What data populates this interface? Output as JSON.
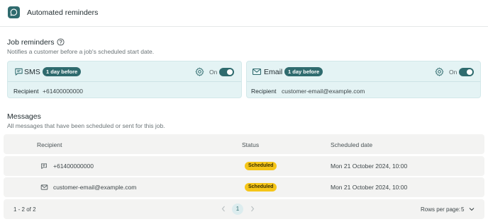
{
  "header": {
    "title": "Automated reminders",
    "icon": "chat-bubble-icon"
  },
  "job_reminders": {
    "title": "Job reminders",
    "subtitle": "Notifies a customer before a job's scheduled start date.",
    "cards": [
      {
        "channel": "SMS",
        "badge": "1 day before",
        "toggle_label": "On",
        "enabled": true,
        "row_label": "Recipient",
        "row_value": "+61400000000",
        "icon": "sms-icon"
      },
      {
        "channel": "Email",
        "badge": "1 day before",
        "toggle_label": "On",
        "enabled": true,
        "row_label": "Recipient",
        "row_value": "customer-email@example.com",
        "icon": "mail-icon"
      }
    ]
  },
  "messages": {
    "title": "Messages",
    "subtitle": "All messages that have been scheduled or sent for this job.",
    "columns": [
      "Recipient",
      "Status",
      "Scheduled date"
    ],
    "rows": [
      {
        "recipient": "+61400000000",
        "status": "Scheduled",
        "date": "Mon 21 October 2024, 10:00",
        "icon": "sms-icon"
      },
      {
        "recipient": "customer-email@example.com",
        "status": "Scheduled",
        "date": "Mon 21 October 2024, 10:00",
        "icon": "mail-icon"
      }
    ],
    "footer": {
      "range": "1 - 2 of 2",
      "page": "1",
      "rows_per_page_label": "Rows per page:",
      "rows_per_page": "5"
    }
  },
  "colors": {
    "accent": "#2f6b6e",
    "card_bg": "#e4f3f4",
    "status_scheduled": "#f5c518",
    "row_bg": "#f3f3f2"
  }
}
